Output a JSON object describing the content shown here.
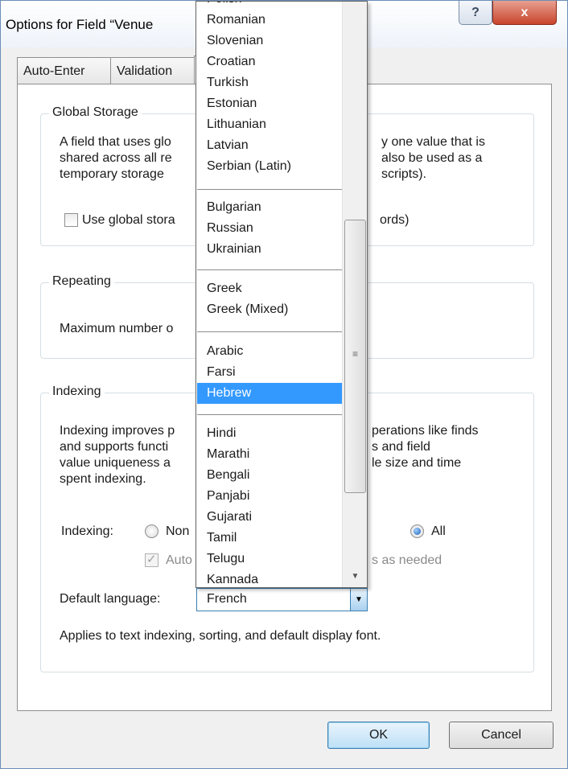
{
  "window": {
    "title": "Options for Field “Venue"
  },
  "titlebar": {
    "help_label": "?",
    "close_label": "x"
  },
  "tabs": [
    {
      "label": "Auto-Enter"
    },
    {
      "label": "Validation"
    },
    {
      "label": ""
    }
  ],
  "global_storage": {
    "title": "Global Storage",
    "lines": [
      "A field that uses glo",
      "shared across all re",
      "temporary storage",
      "y one value that is",
      "also be used as a",
      "scripts)."
    ],
    "checkbox_label": "Use global stora",
    "checkbox_label_tail": "ords)"
  },
  "repeating": {
    "title": "Repeating",
    "label": "Maximum number o"
  },
  "indexing": {
    "title": "Indexing",
    "lines": [
      "Indexing improves p",
      "and supports functi",
      "value uniqueness a",
      "spent indexing.",
      "perations like finds",
      "s and field",
      "le size and time"
    ],
    "indexing_label": "Indexing:",
    "radio_none_label": "Non",
    "radio_all_label": "All",
    "auto_label": "Auto",
    "auto_tail": "s as needed",
    "default_language_label": "Default language:",
    "default_language_value": "French",
    "applies_text": "Applies to text indexing, sorting, and default display font."
  },
  "buttons": {
    "ok": "OK",
    "cancel": "Cancel"
  },
  "dropdown": {
    "top_partial": "Polish",
    "group1": [
      "Romanian",
      "Slovenian",
      "Croatian",
      "Turkish",
      "Estonian",
      "Lithuanian",
      "Latvian",
      "Serbian (Latin)"
    ],
    "group2": [
      "Bulgarian",
      "Russian",
      "Ukrainian"
    ],
    "group3": [
      "Greek",
      "Greek (Mixed)"
    ],
    "group4": [
      "Arabic",
      "Farsi",
      "Hebrew"
    ],
    "group5": [
      "Hindi",
      "Marathi",
      "Bengali",
      "Panjabi",
      "Gujarati",
      "Tamil",
      "Telugu",
      "Kannada"
    ],
    "selected": "Hebrew"
  },
  "icons": {
    "select_arrow": "chevron-down-icon",
    "scroll_grip": "scroll-grip-icon",
    "scroll_down": "scroll-down-icon"
  },
  "colors": {
    "selection": "#3399ff",
    "close_button": "#c8442c",
    "focus_border": "#3c7fb1"
  }
}
